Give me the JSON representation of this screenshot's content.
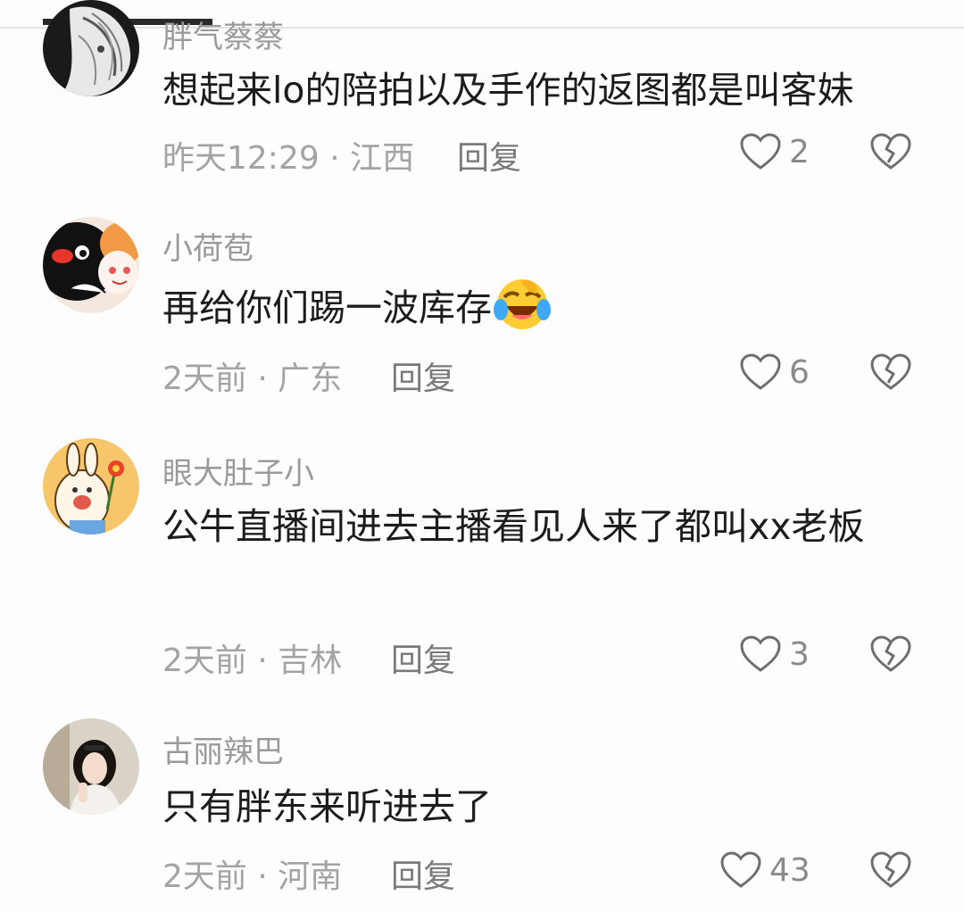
{
  "comments": [
    {
      "username": "胖气蔡蔡",
      "content": "想起来lo的陪拍以及手作的返图都是叫客妹",
      "time_location": "昨天12:29 · 江西",
      "reply_label": "回复",
      "likes": "2",
      "avatar_icon": "avatar-manga-portrait"
    },
    {
      "username": "小荷苞",
      "content": "再给你们踢一波库存",
      "emoji_icon": "laughing-crying-emoji",
      "time_location": "2天前 · 广东",
      "reply_label": "回复",
      "likes": "6",
      "avatar_icon": "avatar-penguin-cartoon"
    },
    {
      "username": "眼大肚子小",
      "content": "公牛直播间进去主播看见人来了都叫xx老板",
      "time_location": "2天前 · 吉林",
      "reply_label": "回复",
      "likes": "3",
      "avatar_icon": "avatar-bunny-flower"
    },
    {
      "username": "古丽辣巴",
      "content": "只有胖东来听进去了",
      "time_location": "2天前 · 河南",
      "reply_label": "回复",
      "likes": "43",
      "avatar_icon": "avatar-woman-photo"
    }
  ],
  "icons": {
    "like": "heart-outline-icon",
    "dislike": "broken-heart-icon"
  },
  "colors": {
    "meta_text": "#a3a3a3",
    "username": "#9a9a9a",
    "icon_stroke": "#6e6e6e"
  }
}
